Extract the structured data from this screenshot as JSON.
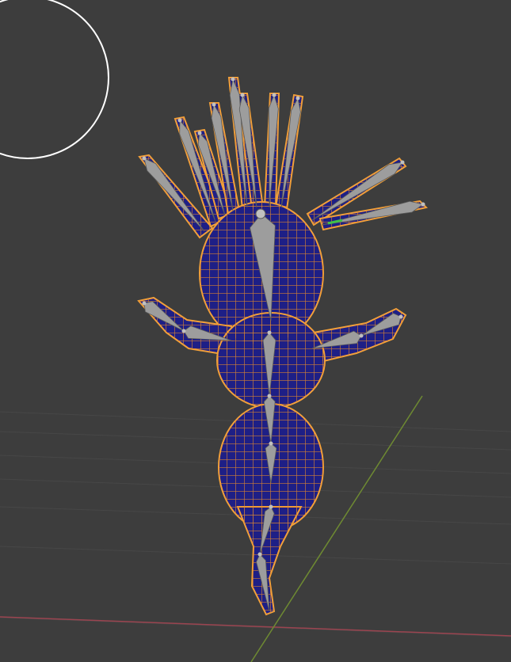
{
  "viewport": {
    "background": "#3d3d3d",
    "grid_color": "#474747",
    "x_axis_color": "#9b4450",
    "y_axis_color": "#6e8a32",
    "cursor_circle_color": "#ffffff",
    "cursor_circle_icon": "brush-radius-circle",
    "mesh": {
      "fill_color": "#1e1f86",
      "wire_color": "#e58a2a",
      "outline_color": "#f2a03a"
    },
    "armature": {
      "bone_color": "#9d9d9d",
      "bone_edge_color": "#5a5a5a",
      "active_bone_color": "#3fc14a",
      "joint_color": "#c0c0c0"
    }
  }
}
